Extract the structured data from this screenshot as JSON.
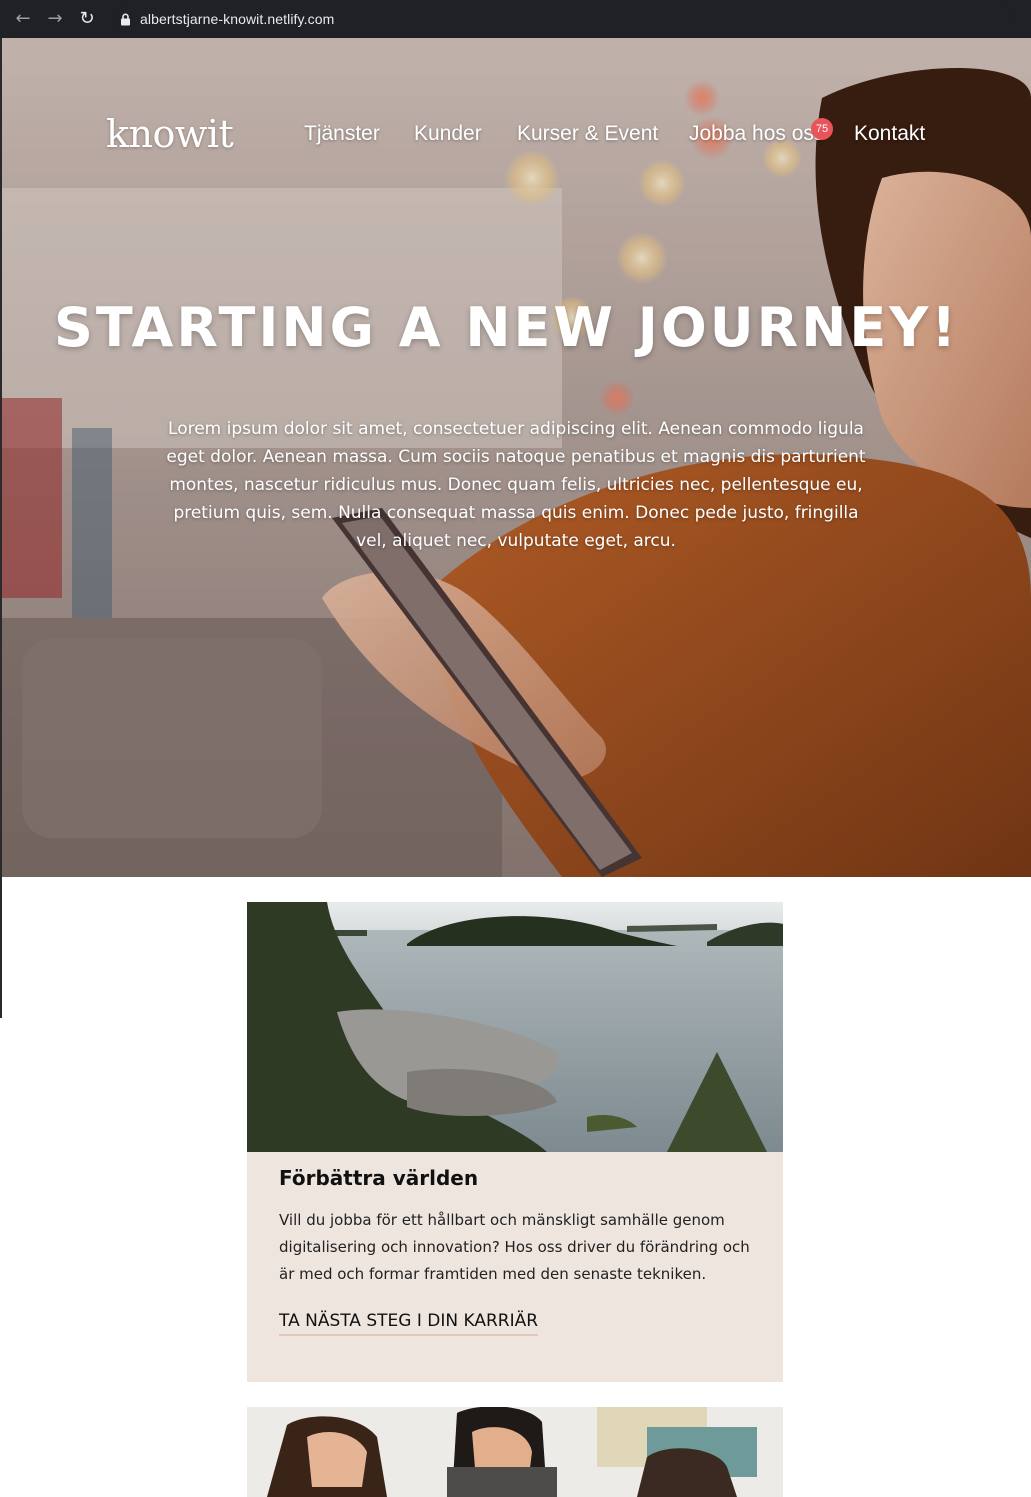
{
  "browser": {
    "url": "albertstjarne-knowit.netlify.com"
  },
  "header": {
    "logo": "knowit",
    "nav": [
      {
        "label": "Tjänster"
      },
      {
        "label": "Kunder"
      },
      {
        "label": "Kurser & Event"
      },
      {
        "label": "Jobba hos oss",
        "badge": "75"
      },
      {
        "label": "Kontakt"
      }
    ]
  },
  "hero": {
    "title": "STARTING A NEW JOURNEY!",
    "text": "Lorem ipsum dolor sit amet, consectetuer adipiscing elit. Aenean commodo ligula eget dolor. Aenean massa. Cum sociis natoque penatibus et magnis dis parturient montes, nascetur ridiculus mus. Donec quam felis, ultricies nec, pellentesque eu, pretium quis, sem. Nulla consequat massa quis enim. Donec pede justo, fringilla vel, aliquet nec, vulputate eget, arcu."
  },
  "cards": [
    {
      "title": "Förbättra världen",
      "text": "Vill du jobba för ett hållbart och mänskligt samhälle genom digitalisering och innovation? Hos oss driver du förändring och är med och formar framtiden med den senaste tekniken.",
      "link": "TA NÄSTA STEG I DIN KARRIÄR"
    }
  ],
  "colors": {
    "card_bg": "#efe5df",
    "badge": "#e8545a",
    "link_underline": "#e4c6bd"
  }
}
